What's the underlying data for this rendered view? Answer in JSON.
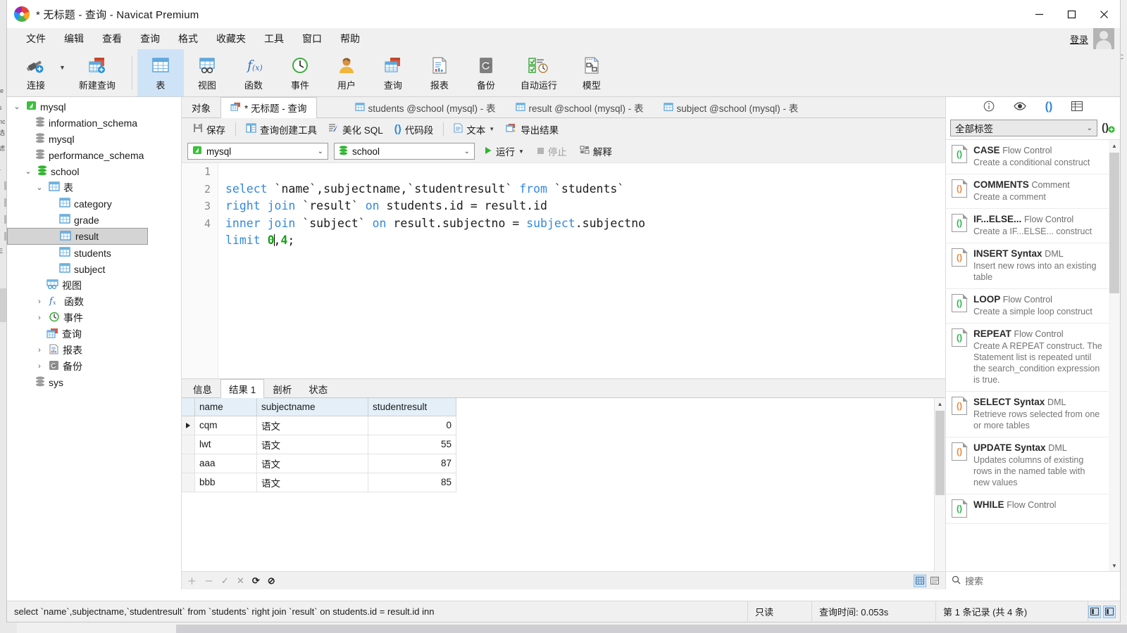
{
  "window": {
    "title": "* 无标题 - 查询 - Navicat Premium",
    "minimize": "–",
    "maximize": "□",
    "close": "✕"
  },
  "menubar": {
    "items": [
      "文件",
      "编辑",
      "查看",
      "查询",
      "格式",
      "收藏夹",
      "工具",
      "窗口",
      "帮助"
    ],
    "login_label": "登录"
  },
  "ribbon": {
    "items": [
      {
        "label": "连接",
        "icon": "connection-icon"
      },
      {
        "label": "新建查询",
        "icon": "new-query-icon"
      },
      {
        "label": "表",
        "icon": "table-icon"
      },
      {
        "label": "视图",
        "icon": "view-icon"
      },
      {
        "label": "函数",
        "icon": "function-icon"
      },
      {
        "label": "事件",
        "icon": "event-icon"
      },
      {
        "label": "用户",
        "icon": "user-icon"
      },
      {
        "label": "查询",
        "icon": "query-icon"
      },
      {
        "label": "报表",
        "icon": "report-icon"
      },
      {
        "label": "备份",
        "icon": "backup-icon"
      },
      {
        "label": "自动运行",
        "icon": "automation-icon"
      },
      {
        "label": "模型",
        "icon": "model-icon"
      }
    ],
    "active": "表"
  },
  "sidebar": {
    "tree": [
      {
        "label": "mysql",
        "depth": 0,
        "icon": "connection-icon",
        "twisty": "down",
        "selected": false
      },
      {
        "label": "information_schema",
        "depth": 1,
        "icon": "db-gray",
        "twisty": "",
        "selected": false
      },
      {
        "label": "mysql",
        "depth": 1,
        "icon": "db-gray",
        "twisty": "",
        "selected": false
      },
      {
        "label": "performance_schema",
        "depth": 1,
        "icon": "db-gray",
        "twisty": "",
        "selected": false
      },
      {
        "label": "school",
        "depth": 1,
        "icon": "db-green",
        "twisty": "down",
        "selected": false
      },
      {
        "label": "表",
        "depth": 2,
        "icon": "table-folder-icon",
        "twisty": "down",
        "selected": false
      },
      {
        "label": "category",
        "depth": 3,
        "icon": "table-icon",
        "twisty": "",
        "selected": false
      },
      {
        "label": "grade",
        "depth": 3,
        "icon": "table-icon",
        "twisty": "",
        "selected": false
      },
      {
        "label": "result",
        "depth": 3,
        "icon": "table-icon",
        "twisty": "",
        "selected": true
      },
      {
        "label": "students",
        "depth": 3,
        "icon": "table-icon",
        "twisty": "",
        "selected": false
      },
      {
        "label": "subject",
        "depth": 3,
        "icon": "table-icon",
        "twisty": "",
        "selected": false
      },
      {
        "label": "视图",
        "depth": 2,
        "icon": "view-icon",
        "twisty": "",
        "selected": false
      },
      {
        "label": "函数",
        "depth": 2,
        "icon": "function-icon",
        "twisty": "right",
        "selected": false
      },
      {
        "label": "事件",
        "depth": 2,
        "icon": "event-icon",
        "twisty": "right",
        "selected": false
      },
      {
        "label": "查询",
        "depth": 2,
        "icon": "query-icon",
        "twisty": "",
        "selected": false
      },
      {
        "label": "报表",
        "depth": 2,
        "icon": "report-icon",
        "twisty": "right",
        "selected": false
      },
      {
        "label": "备份",
        "depth": 2,
        "icon": "backup-icon",
        "twisty": "right",
        "selected": false
      },
      {
        "label": "sys",
        "depth": 1,
        "icon": "db-gray",
        "twisty": "",
        "selected": false
      }
    ]
  },
  "tabs": {
    "items": [
      {
        "label": "对象",
        "active": false,
        "icon": ""
      },
      {
        "label": "* 无标题 - 查询",
        "active": true,
        "icon": "query-icon"
      },
      {
        "label": "students @school (mysql) - 表",
        "active": false,
        "icon": "table-icon"
      },
      {
        "label": "result @school (mysql) - 表",
        "active": false,
        "icon": "table-icon"
      },
      {
        "label": "subject @school (mysql) - 表",
        "active": false,
        "icon": "table-icon"
      }
    ]
  },
  "query_toolbar": {
    "buttons": [
      {
        "label": "保存",
        "icon": "save-icon"
      },
      {
        "label": "查询创建工具",
        "icon": "query-builder-icon"
      },
      {
        "label": "美化 SQL",
        "icon": "beautify-sql-icon"
      },
      {
        "label": "代码段",
        "icon": "snippet-icon"
      },
      {
        "label": "文本",
        "icon": "text-icon",
        "caret": true
      },
      {
        "label": "导出结果",
        "icon": "export-icon"
      }
    ]
  },
  "connection_row": {
    "connection": "mysql",
    "database": "school",
    "run_label": "运行",
    "stop_label": "停止",
    "explain_label": "解释"
  },
  "editor": {
    "line_numbers": [
      "1",
      "2",
      "3",
      "4"
    ],
    "lines": [
      "select `name`,subjectname,`studentresult` from `students`",
      "right join `result` on students.id = result.id",
      "inner join `subject` on result.subjectno = subject.subjectno",
      "limit 0,4;"
    ]
  },
  "result_tabs": {
    "items": [
      "信息",
      "结果 1",
      "剖析",
      "状态"
    ],
    "active": "结果 1"
  },
  "result_grid": {
    "columns": [
      "name",
      "subjectname",
      "studentresult"
    ],
    "rows": [
      {
        "name": "cqm",
        "subjectname": "语文",
        "studentresult": "0",
        "current": true
      },
      {
        "name": "lwt",
        "subjectname": "语文",
        "studentresult": "55",
        "current": false
      },
      {
        "name": "aaa",
        "subjectname": "语文",
        "studentresult": "87",
        "current": false
      },
      {
        "name": "bbb",
        "subjectname": "语文",
        "studentresult": "85",
        "current": false
      }
    ]
  },
  "grid_toolbar": {
    "icons": [
      "add-row-icon",
      "remove-row-icon",
      "apply-icon",
      "cancel-icon",
      "refresh-icon",
      "stop-icon"
    ],
    "view_grid": "grid-view-icon",
    "view_form": "form-view-icon"
  },
  "right_panel": {
    "top_icons": [
      "info-icon",
      "preview-icon",
      "snippets-icon",
      "structure-icon"
    ],
    "filter_value": "全部标签",
    "add_snippet_icon": "add-snippet-icon",
    "search_placeholder": "搜索",
    "snippets": [
      {
        "name": "CASE",
        "category": "Flow Control",
        "desc": "Create a conditional construct",
        "color": "#2ab34a"
      },
      {
        "name": "COMMENTS",
        "category": "Comment",
        "desc": "Create a comment",
        "color": "#e8873a"
      },
      {
        "name": "IF...ELSE...",
        "category": "Flow Control",
        "desc": "Create a IF...ELSE... construct",
        "color": "#2ab34a"
      },
      {
        "name": "INSERT Syntax",
        "category": "DML",
        "desc": "Insert new rows into an existing table",
        "color": "#e8873a"
      },
      {
        "name": "LOOP",
        "category": "Flow Control",
        "desc": "Create a simple loop construct",
        "color": "#2ab34a"
      },
      {
        "name": "REPEAT",
        "category": "Flow Control",
        "desc": "Create A REPEAT construct. The Statement list is repeated until the search_condition expression is true.",
        "color": "#2ab34a"
      },
      {
        "name": "SELECT Syntax",
        "category": "DML",
        "desc": "Retrieve rows selected from one or more tables",
        "color": "#e8873a"
      },
      {
        "name": "UPDATE Syntax",
        "category": "DML",
        "desc": "Updates columns of existing rows in the named table with new values",
        "color": "#e8873a"
      },
      {
        "name": "WHILE",
        "category": "Flow Control",
        "desc": "",
        "color": "#2ab34a"
      }
    ]
  },
  "statusbar": {
    "sql": "select `name`,subjectname,`studentresult` from `students` right join `result` on students.id = result.id inn",
    "readonly": "只读",
    "query_time": "查询时间: 0.053s",
    "record_info": "第 1 条记录 (共 4 条)"
  }
}
